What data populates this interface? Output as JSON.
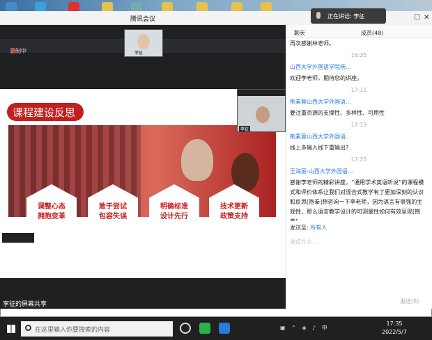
{
  "window": {
    "title": "腾讯会议",
    "speaking": "正在讲话: 李征"
  },
  "recording": {
    "label": "录制中"
  },
  "participant_video": {
    "name": "李征"
  },
  "slide": {
    "title": "课程建设反思",
    "items": [
      {
        "line1": "调整心态",
        "line2": "拥抱变革"
      },
      {
        "line1": "敢于尝试",
        "line2": "包容失误"
      },
      {
        "line1": "明确标准",
        "line2": "设计先行"
      },
      {
        "line1": "技术更新",
        "line2": "政策支持"
      }
    ]
  },
  "presenter_cam": {
    "name": "李征"
  },
  "share": {
    "label": "李征的屏幕共享"
  },
  "chat": {
    "tab_chat": "聊天",
    "tab_members": "成员(48)",
    "messages": [
      {
        "type": "text",
        "text": "再次感谢林老师。"
      },
      {
        "type": "time",
        "text": "16:35"
      },
      {
        "type": "sender",
        "text": "山西大学外国语学院杨..."
      },
      {
        "type": "text",
        "text": "欢迎李老师，期待您的讲座。"
      },
      {
        "type": "time",
        "text": "17:11"
      },
      {
        "type": "sender",
        "text": "荆素蓉山西大学外国语..."
      },
      {
        "type": "text",
        "text": "要注重资源的支撑性、多样性、可用性"
      },
      {
        "type": "time",
        "text": "17:15"
      },
      {
        "type": "sender",
        "text": "荆素蓉山西大学外国语..."
      },
      {
        "type": "text",
        "text": "线上多输入线下重输出?"
      },
      {
        "type": "time",
        "text": "17:25"
      },
      {
        "type": "sender",
        "text": "王海丽-山西大学外国语..."
      },
      {
        "type": "text",
        "text": "感谢李老师的精彩讲座，“通用学术英语听说”的课程模式和评价体系让我们对混合式教学有了更加深刻的认识和反思[抱拳]想咨询一下李老师，因为语言有很强的主观性，那么语言教学设计的可测量性如何有效呈现[抱拳]"
      }
    ],
    "send_to_label": "发送至:",
    "send_to_value": "所有人",
    "input_placeholder": "说点什么...",
    "send_button": "发送(S)"
  },
  "taskbar": {
    "search_placeholder": "在这里输入你要搜索的内容",
    "tray_lang": "中",
    "time": "17:35",
    "date": "2022/5/7"
  }
}
